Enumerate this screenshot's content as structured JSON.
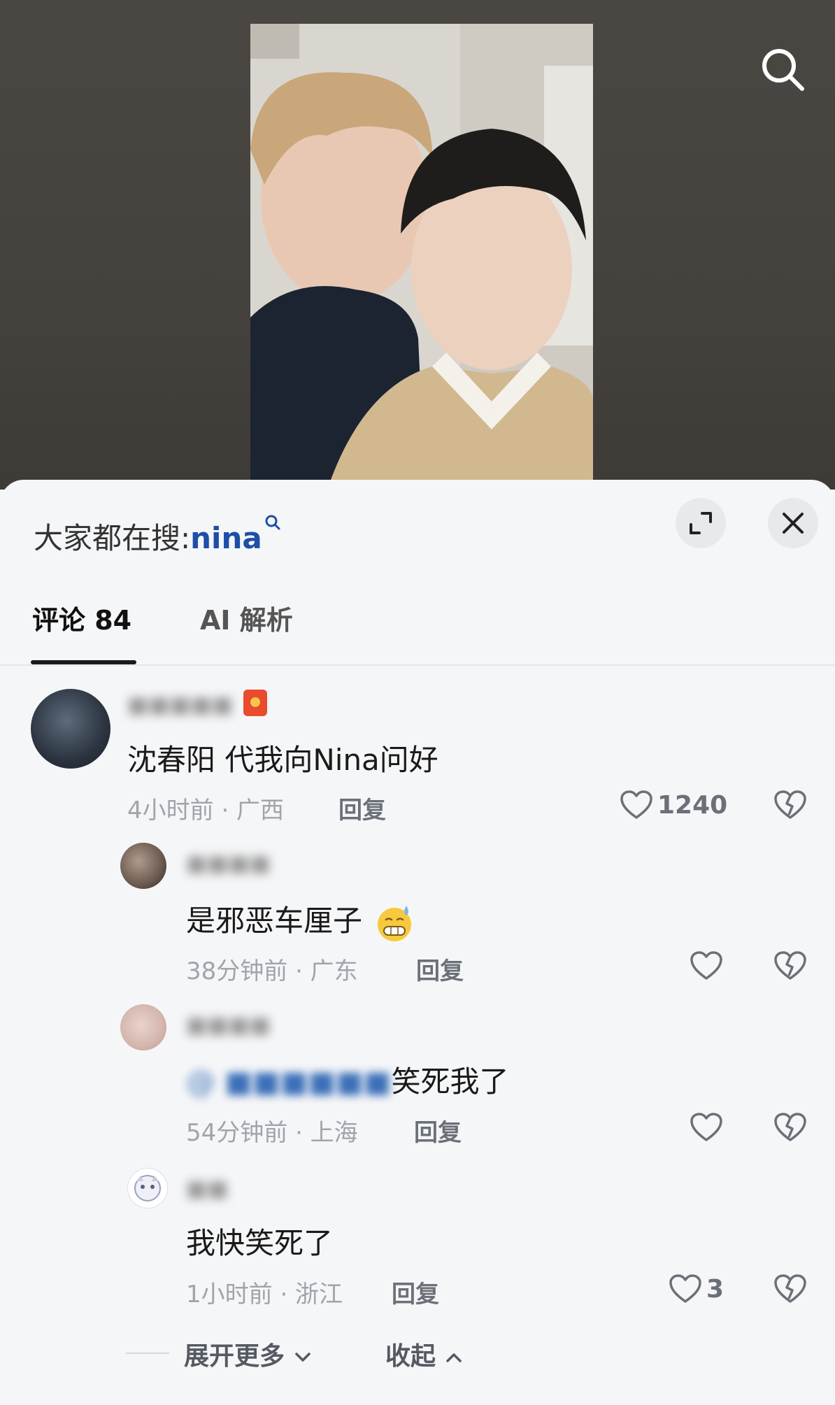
{
  "hot_search": {
    "prefix": "大家都在搜:",
    "keyword": "nina"
  },
  "tabs": [
    {
      "label": "评论 84"
    },
    {
      "label": "AI 解析"
    }
  ],
  "comments": [
    {
      "username": "■■■■■",
      "text": "沈春阳 代我向Nina问好",
      "meta": "4小时前 · 广西",
      "reply": "回复",
      "likes": "1240"
    },
    {
      "username": "■■■■",
      "text": "是邪恶车厘子",
      "meta": "38分钟前 · 广东",
      "reply": "回复",
      "likes": ""
    },
    {
      "username": "■■■■",
      "mention": "@ ■■■■■■",
      "text": "笑死我了",
      "meta": "54分钟前 · 上海",
      "reply": "回复",
      "likes": ""
    },
    {
      "username": "■■",
      "text": "我快笑死了",
      "meta": "1小时前 · 浙江",
      "reply": "回复",
      "likes": "3"
    }
  ],
  "footer": {
    "expand_more": "展开更多",
    "collapse": "收起"
  },
  "icons": {
    "search": "search-icon",
    "expand": "expand-icon",
    "close": "close-icon",
    "like": "heart-icon",
    "dislike": "broken-heart-icon"
  },
  "colors": {
    "keyword": "#1d4ea8",
    "sheet_bg": "#f5f6f8"
  }
}
